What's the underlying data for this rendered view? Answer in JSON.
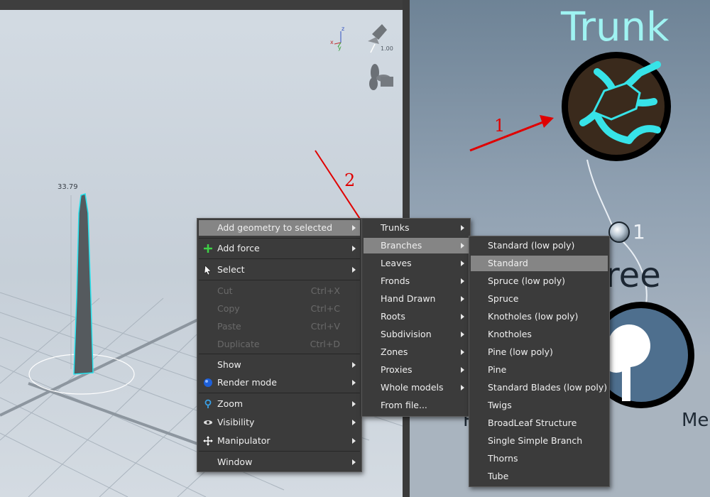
{
  "viewport": {
    "height_label": "33.79",
    "zoom_readout": "1.00",
    "axis_labels": [
      "z",
      "y",
      "x"
    ]
  },
  "graph": {
    "trunk_title": "Trunk",
    "tree_title_partial": "ree",
    "link_count": "1",
    "cut_text_left": "F",
    "cut_text_right": "Me"
  },
  "annotations": {
    "arrow1": "1",
    "arrow2": "2"
  },
  "colors": {
    "accent_cyan": "#9ff3f2",
    "annotation_red": "#e00000",
    "menu_bg": "#3b3b3b",
    "highlight": "#858585"
  },
  "context_menu": {
    "items": [
      {
        "label": "Add geometry to selected",
        "submenu": true
      },
      {
        "label": "Add force",
        "icon": "plus-icon",
        "submenu": true
      },
      {
        "label": "Select",
        "icon": "cursor-icon",
        "submenu": true
      },
      {
        "label": "Cut",
        "shortcut": "Ctrl+X"
      },
      {
        "label": "Copy",
        "shortcut": "Ctrl+C"
      },
      {
        "label": "Paste",
        "shortcut": "Ctrl+V"
      },
      {
        "label": "Duplicate",
        "shortcut": "Ctrl+D"
      },
      {
        "label": "Show",
        "submenu": true
      },
      {
        "label": "Render mode",
        "icon": "sphere-icon",
        "submenu": true
      },
      {
        "label": "Zoom",
        "icon": "magnifier-icon",
        "submenu": true
      },
      {
        "label": "Visibility",
        "icon": "eye-icon",
        "submenu": true
      },
      {
        "label": "Manipulator",
        "icon": "move-icon",
        "submenu": true
      },
      {
        "label": "Window",
        "submenu": true
      }
    ]
  },
  "geometry_menu": {
    "items": [
      "Trunks",
      "Branches",
      "Leaves",
      "Fronds",
      "Hand Drawn",
      "Roots",
      "Subdivision",
      "Zones",
      "Proxies",
      "Whole models",
      "From file..."
    ]
  },
  "branches_menu": {
    "items": [
      "Standard (low poly)",
      "Standard",
      "Spruce (low poly)",
      "Spruce",
      "Knotholes (low poly)",
      "Knotholes",
      "Pine (low poly)",
      "Pine",
      "Standard Blades (low poly)",
      "Twigs",
      "BroadLeaf Structure",
      "Single Simple Branch",
      "Thorns",
      "Tube"
    ]
  }
}
